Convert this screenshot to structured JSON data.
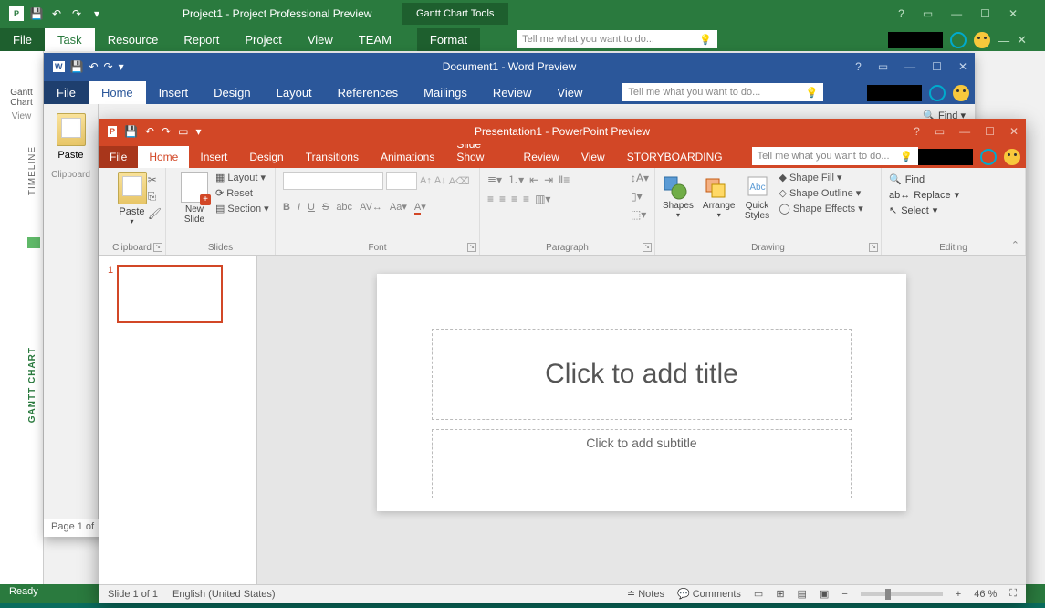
{
  "project": {
    "title": "Project1 - Project Professional Preview",
    "tools": "Gantt Chart Tools",
    "tabs": {
      "file": "File",
      "task": "Task",
      "resource": "Resource",
      "report": "Report",
      "project": "Project",
      "view": "View",
      "team": "TEAM",
      "format": "Format"
    },
    "tellme": "Tell me what you want to do...",
    "ganttbtn": "Gantt\nChart",
    "viewlbl": "View",
    "timeline": "TIMELINE",
    "ganttchart": "GANTT CHART",
    "status": "Ready"
  },
  "word": {
    "title": "Document1 - Word Preview",
    "tabs": {
      "file": "File",
      "home": "Home",
      "insert": "Insert",
      "design": "Design",
      "layout": "Layout",
      "references": "References",
      "mailings": "Mailings",
      "review": "Review",
      "view": "View"
    },
    "tellme": "Tell me what you want to do...",
    "paste": "Paste",
    "clipboard": "Clipboard",
    "find": "Find",
    "page": "Page 1 of"
  },
  "pp": {
    "title": "Presentation1 - PowerPoint Preview",
    "tabs": {
      "file": "File",
      "home": "Home",
      "insert": "Insert",
      "design": "Design",
      "transitions": "Transitions",
      "animations": "Animations",
      "slideshow": "Slide Show",
      "review": "Review",
      "view": "View",
      "storyboarding": "STORYBOARDING"
    },
    "tellme": "Tell me what you want to do...",
    "clipboard": {
      "paste": "Paste",
      "label": "Clipboard"
    },
    "slides": {
      "new": "New\nSlide",
      "layout": "Layout",
      "reset": "Reset",
      "section": "Section",
      "label": "Slides"
    },
    "font": {
      "label": "Font"
    },
    "para": {
      "label": "Paragraph"
    },
    "drawing": {
      "shapes": "Shapes",
      "arrange": "Arrange",
      "quick": "Quick\nStyles",
      "fill": "Shape Fill",
      "outline": "Shape Outline",
      "effects": "Shape Effects",
      "label": "Drawing"
    },
    "editing": {
      "find": "Find",
      "replace": "Replace",
      "select": "Select",
      "label": "Editing"
    },
    "slide": {
      "num": "1",
      "title": "Click to add title",
      "subtitle": "Click to add subtitle"
    },
    "status": {
      "slide": "Slide 1 of 1",
      "lang": "English (United States)",
      "notes": "Notes",
      "comments": "Comments",
      "zoom": "46 %"
    }
  }
}
